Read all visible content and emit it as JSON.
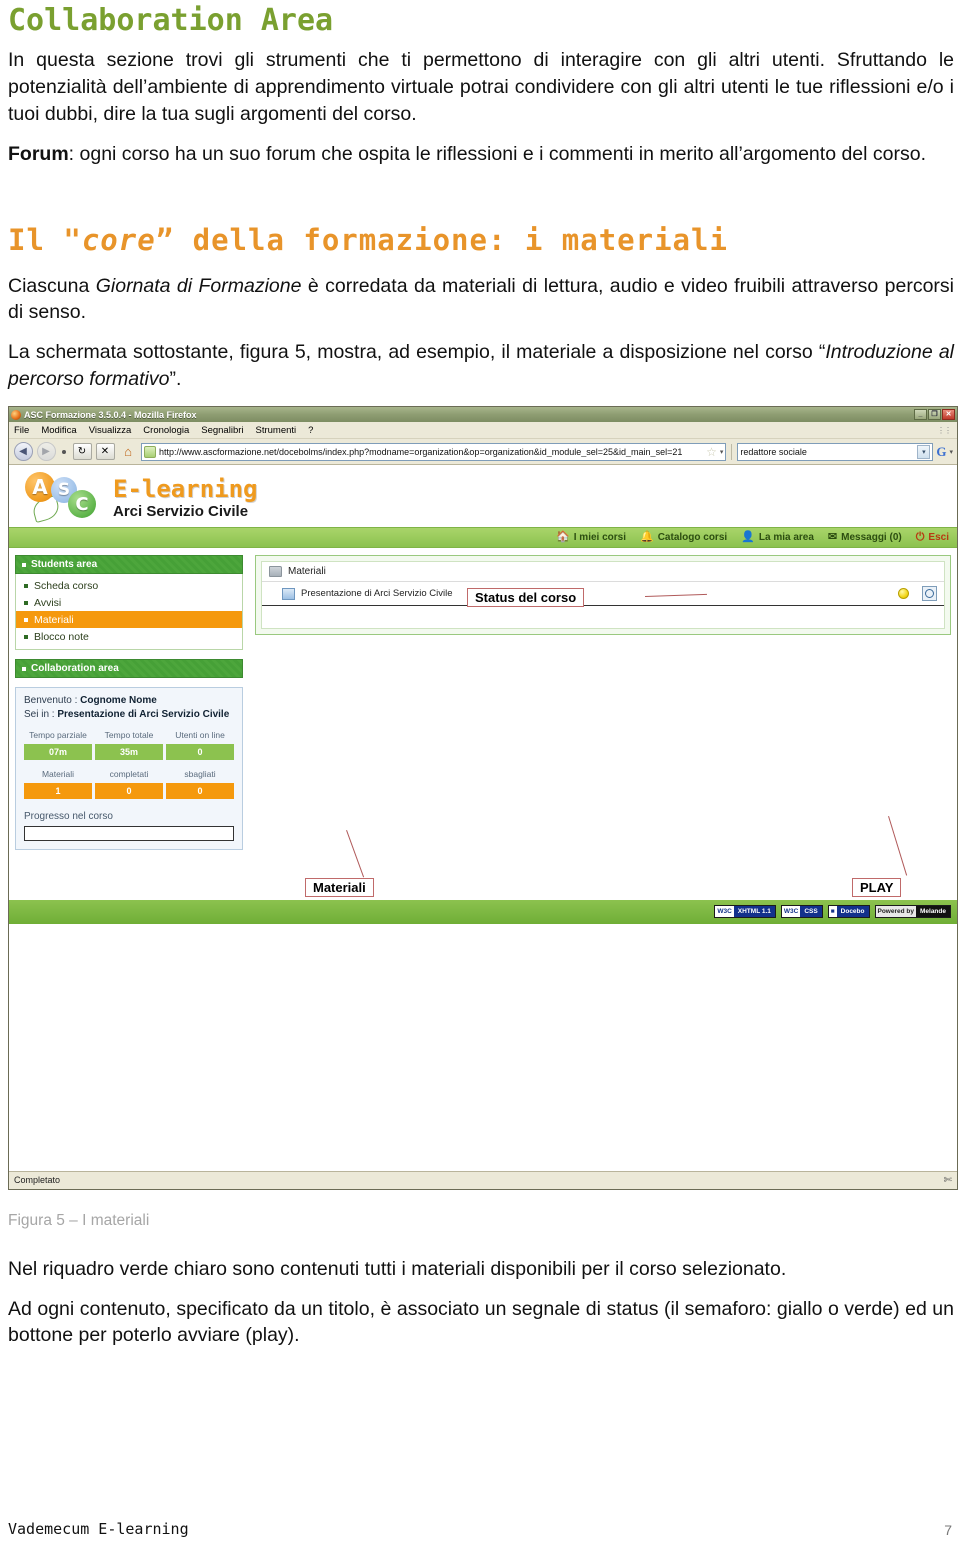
{
  "document": {
    "heading_1": "Collaboration Area",
    "para_1": "In questa sezione trovi gli strumenti che ti permettono di interagire con gli altri utenti. Sfruttando le potenzialità dell’ambiente di apprendimento virtuale potrai condividere con gli altri utenti le tue riflessioni e/o i tuoi dubbi, dire la tua sugli argomenti del corso.",
    "para_2_label": "Forum",
    "para_2_rest": ": ogni corso ha un suo forum che ospita le riflessioni e i commenti in merito all’argomento del corso.",
    "heading_2_pre": "Il \"",
    "heading_2_em": "core",
    "heading_2_post": "” della formazione: i materiali",
    "para_3_a": "Ciascuna ",
    "para_3_em": "Giornata di Formazione",
    "para_3_b": " è corredata da materiali di lettura, audio e video fruibili attraverso percorsi di senso.",
    "para_4_a": "La schermata sottostante, figura 5, mostra, ad esempio, il materiale a disposizione nel corso “",
    "para_4_em": "Introduzione al percorso formativo",
    "para_4_b": "”.",
    "caption": "Figura 5 – I materiali",
    "para_5": "Nel riquadro verde chiaro sono contenuti tutti i materiali disponibili per il corso selezionato.",
    "para_6": "Ad ogni contenuto, specificato da un titolo, è associato un segnale di status (il semaforo: giallo o verde) ed un bottone per poterlo avviare (play).",
    "footer_left": "Vademecum E-learning",
    "footer_page": "7"
  },
  "colors": {
    "heading_green": "#7aa030",
    "heading_orange": "#e8942a",
    "nav_green": "#8cc24f",
    "highlight_orange": "#f5990d",
    "callout_red": "#c06a6a"
  },
  "browser": {
    "window_title": "ASC Formazione 3.5.0.4 - Mozilla Firefox",
    "window_buttons": {
      "minimize": "_",
      "maximize": "❐",
      "close": "✕"
    },
    "menu": [
      "File",
      "Modifica",
      "Visualizza",
      "Cronologia",
      "Segnalibri",
      "Strumenti",
      "?"
    ],
    "toolbar": {
      "back": "◀",
      "forward": "▶",
      "reload": "↻",
      "stop": "✕",
      "home": "⌂"
    },
    "url": "http://www.ascformazione.net/docebolms/index.php?modname=organization&op=organization&id_module_sel=25&id_main_sel=21",
    "search_value": "redattore sociale",
    "search_engine_icon": "G",
    "status_text": "Completato"
  },
  "site": {
    "brand_title": "E-learning",
    "brand_subtitle": "Arci Servizio Civile",
    "logo_letters": [
      "A",
      "S",
      "C"
    ],
    "nav": [
      {
        "label": "I miei corsi",
        "icon": "🏠"
      },
      {
        "label": "Catalogo corsi",
        "icon": "🔔"
      },
      {
        "label": "La mia area",
        "icon": "👤"
      },
      {
        "label": "Messaggi (0)",
        "icon": "✉"
      },
      {
        "label": "Esci",
        "icon": "⏻"
      }
    ],
    "sidebar": {
      "students_area_title": "Students area",
      "students_items": [
        {
          "label": "Scheda corso",
          "active": false
        },
        {
          "label": "Avvisi",
          "active": false
        },
        {
          "label": "Materiali",
          "active": true
        },
        {
          "label": "Blocco note",
          "active": false
        }
      ],
      "collaboration_area_title": "Collaboration area"
    },
    "info": {
      "welcome_label": "Benvenuto :",
      "welcome_value": "Cognome Nome",
      "location_label": "Sei in :",
      "location_value": "Presentazione di Arci Servizio Civile",
      "stats_row1_headers": [
        "Tempo parziale",
        "Tempo totale",
        "Utenti on line"
      ],
      "stats_row1_values": [
        "07m",
        "35m",
        "0"
      ],
      "stats_row2_headers": [
        "Materiali",
        "completati",
        "sbagliati"
      ],
      "stats_row2_values": [
        "1",
        "0",
        "0"
      ],
      "progress_label": "Progresso nel corso"
    },
    "materials": {
      "folder_label": "Materiali",
      "item_label": "Presentazione di Arci Servizio Civile"
    },
    "footer_badges": [
      {
        "left": "W3C",
        "right": "XHTML 1.1"
      },
      {
        "left": "W3C",
        "right": "CSS"
      },
      {
        "left": "■",
        "right": "Docebo"
      },
      {
        "left": "Powered by",
        "right": "Melande"
      }
    ]
  },
  "annotations": {
    "status_callout": "Status del corso",
    "materiali_callout": "Materiali",
    "play_callout": "PLAY"
  }
}
